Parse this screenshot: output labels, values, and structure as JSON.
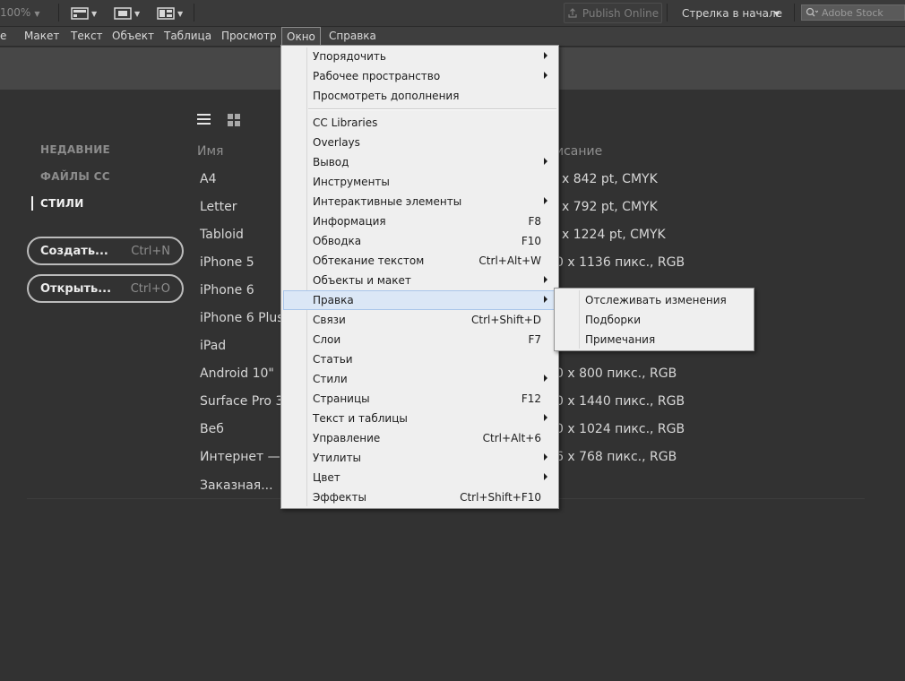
{
  "toolbar": {
    "zoom": "100%",
    "publish_label": "Publish Online",
    "arrow_mode": "Стрелка в начале",
    "stock_placeholder": "Adobe Stock"
  },
  "menubar": {
    "items": [
      "е",
      "Макет",
      "Текст",
      "Объект",
      "Таблица",
      "Просмотр",
      "Окно",
      "Справка"
    ],
    "active": "Окно"
  },
  "start": {
    "nav": [
      "НЕДАВНИЕ",
      "ФАЙЛЫ CC",
      "СТИЛИ"
    ],
    "active_nav": "СТИЛИ",
    "create_label": "Создать...",
    "create_shortcut": "Ctrl+N",
    "open_label": "Открыть...",
    "open_shortcut": "Ctrl+O",
    "col_name": "Имя",
    "col_desc": "исание",
    "rows": [
      {
        "name": "A4",
        "desc": "x 842 pt, CMYK"
      },
      {
        "name": "Letter",
        "desc": "x 792 pt, CMYK"
      },
      {
        "name": "Tabloid",
        "desc": "x 1224 pt, CMYK"
      },
      {
        "name": "iPhone 5",
        "desc": "0 x 1136 пикс., RGB"
      },
      {
        "name": "iPhone 6",
        "desc": ""
      },
      {
        "name": "iPhone 6 Plus",
        "desc": ""
      },
      {
        "name": "iPad",
        "desc": ""
      },
      {
        "name": "Android 10\"",
        "desc": "0 x 800 пикс., RGB"
      },
      {
        "name": "Surface Pro 3",
        "desc": "0 x 1440 пикс., RGB"
      },
      {
        "name": "Веб",
        "desc": "0 x 1024 пикс., RGB"
      },
      {
        "name": "Интернет — C",
        "desc": "6 x 768 пикс., RGB"
      },
      {
        "name": "Заказная...",
        "desc": ""
      }
    ]
  },
  "window_menu": {
    "items": [
      {
        "label": "Упорядочить",
        "shortcut": "",
        "submenu": true
      },
      {
        "label": "Рабочее пространство",
        "shortcut": "",
        "submenu": true
      },
      {
        "label": "Просмотреть дополнения",
        "shortcut": "",
        "submenu": false
      },
      {
        "label": "CC Libraries",
        "shortcut": "",
        "submenu": false
      },
      {
        "label": "Overlays",
        "shortcut": "",
        "submenu": false
      },
      {
        "label": "Вывод",
        "shortcut": "",
        "submenu": true
      },
      {
        "label": "Инструменты",
        "shortcut": "",
        "submenu": false
      },
      {
        "label": "Интерактивные элементы",
        "shortcut": "",
        "submenu": true
      },
      {
        "label": "Информация",
        "shortcut": "F8",
        "submenu": false
      },
      {
        "label": "Обводка",
        "shortcut": "F10",
        "submenu": false
      },
      {
        "label": "Обтекание текстом",
        "shortcut": "Ctrl+Alt+W",
        "submenu": false
      },
      {
        "label": "Объекты и макет",
        "shortcut": "",
        "submenu": true
      },
      {
        "label": "Правка",
        "shortcut": "",
        "submenu": true
      },
      {
        "label": "Связи",
        "shortcut": "Ctrl+Shift+D",
        "submenu": false
      },
      {
        "label": "Слои",
        "shortcut": "F7",
        "submenu": false
      },
      {
        "label": "Статьи",
        "shortcut": "",
        "submenu": false
      },
      {
        "label": "Стили",
        "shortcut": "",
        "submenu": true
      },
      {
        "label": "Страницы",
        "shortcut": "F12",
        "submenu": false
      },
      {
        "label": "Текст и таблицы",
        "shortcut": "",
        "submenu": true
      },
      {
        "label": "Управление",
        "shortcut": "Ctrl+Alt+6",
        "submenu": false
      },
      {
        "label": "Утилиты",
        "shortcut": "",
        "submenu": true
      },
      {
        "label": "Цвет",
        "shortcut": "",
        "submenu": true
      },
      {
        "label": "Эффекты",
        "shortcut": "Ctrl+Shift+F10",
        "submenu": false
      }
    ],
    "highlighted": "Правка"
  },
  "edit_submenu": {
    "items": [
      "Отслеживать изменения",
      "Подборки",
      "Примечания"
    ]
  }
}
